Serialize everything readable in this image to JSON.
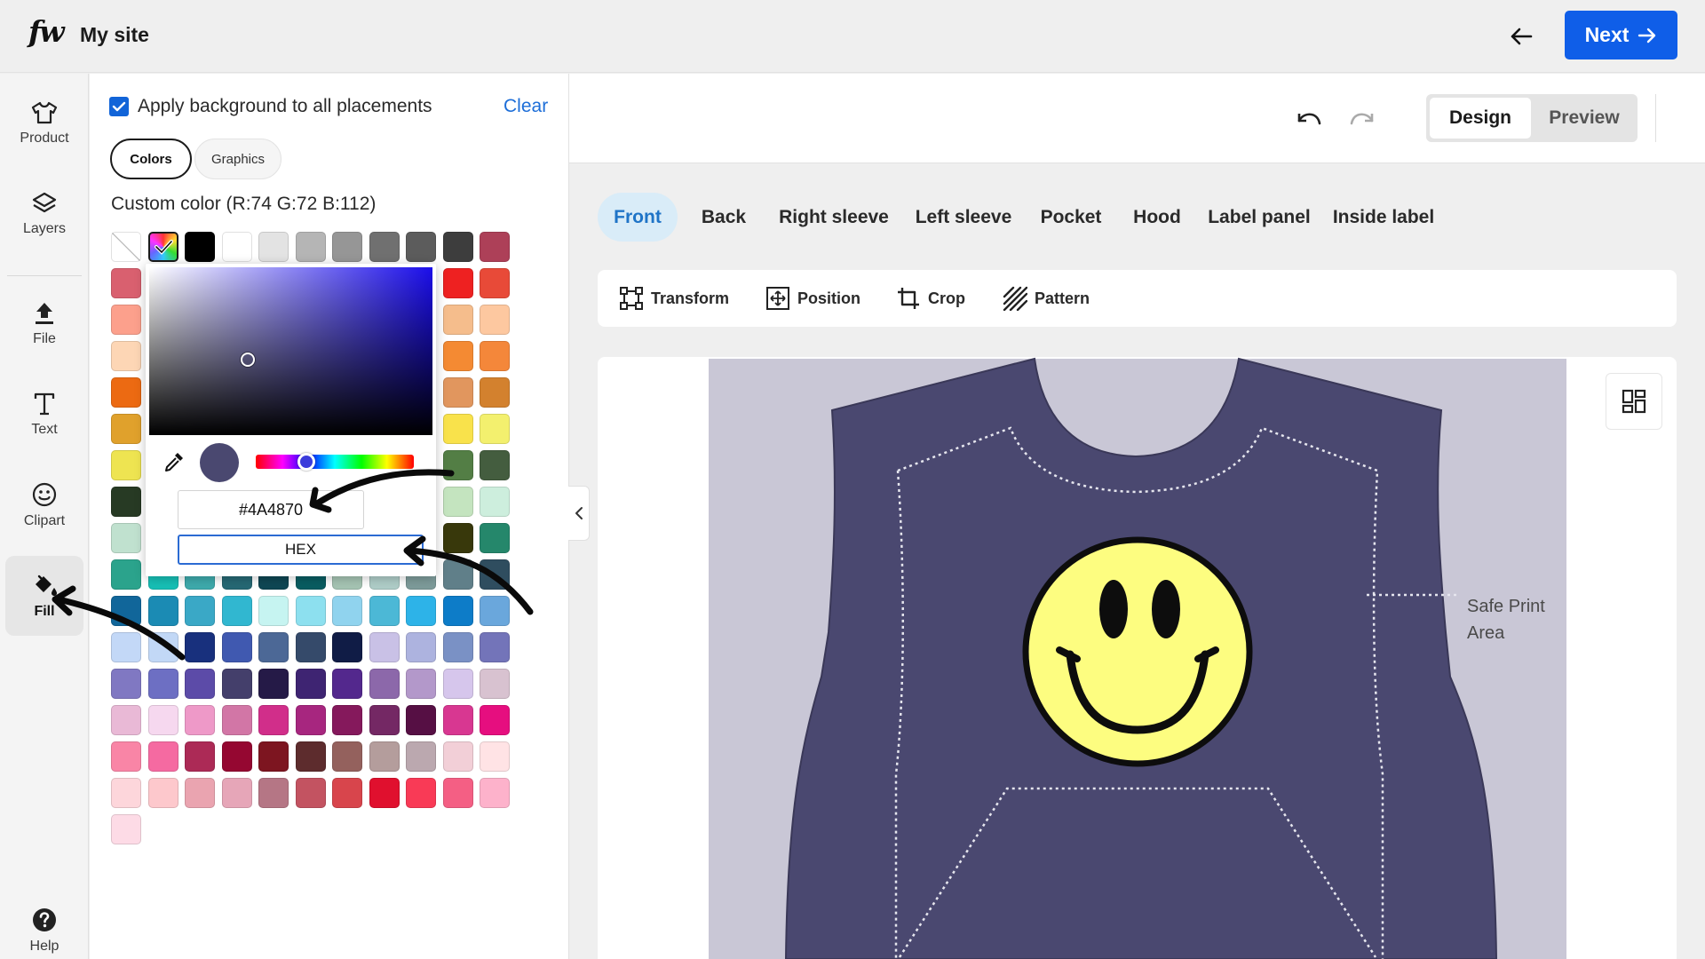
{
  "header": {
    "logo": "fw",
    "site_name": "My site",
    "next_label": "Next"
  },
  "rail": {
    "items": [
      {
        "label": "Product",
        "icon": "shirt-icon"
      },
      {
        "label": "Layers",
        "icon": "layers-icon"
      },
      {
        "label": "File",
        "icon": "upload-icon"
      },
      {
        "label": "Text",
        "icon": "text-icon"
      },
      {
        "label": "Clipart",
        "icon": "smiley-icon"
      },
      {
        "label": "Fill",
        "icon": "paint-bucket-icon"
      },
      {
        "label": "Help",
        "icon": "help-icon"
      }
    ]
  },
  "panel": {
    "apply_label": "Apply background to all placements",
    "apply_checked": true,
    "clear_label": "Clear",
    "pill_colors": "Colors",
    "pill_graphics": "Graphics",
    "custom_color": "Custom color  (R:74 G:72 B:112)",
    "swatches": [
      [
        "none",
        "rainbow",
        "#000000",
        "#ffffff",
        "#e3e3e3",
        "#b5b5b5",
        "#969696",
        "#707070",
        "#5c5c5c",
        "#3d3d3d",
        "#ad4058"
      ],
      [
        "#d9606f",
        "",
        "",
        "",
        "",
        "",
        "",
        "",
        "",
        "#ee2121",
        "#e84a38"
      ],
      [
        "#fca08c",
        "",
        "",
        "",
        "",
        "",
        "",
        "",
        "",
        "#f5bd8c",
        "#fdc8a0"
      ],
      [
        "#fdd6b5",
        "",
        "",
        "",
        "",
        "",
        "",
        "",
        "",
        "#f48a33",
        "#f4873a"
      ],
      [
        "#ec6a12",
        "",
        "",
        "",
        "",
        "",
        "",
        "",
        "",
        "#e1965e",
        "#d3812e"
      ],
      [
        "#e0a12c",
        "",
        "",
        "",
        "",
        "",
        "",
        "",
        "",
        "#f9e24b",
        "#f3f06e"
      ],
      [
        "#eee451",
        "",
        "",
        "",
        "",
        "",
        "",
        "",
        "",
        "#537e45",
        "#445d3f"
      ],
      [
        "#273a24",
        "",
        "",
        "",
        "",
        "",
        "",
        "",
        "",
        "#c4e4bf",
        "#cdeedd"
      ],
      [
        "#c0e1cf",
        "",
        "",
        "",
        "",
        "",
        "",
        "",
        "",
        "#38380b",
        "#25876b"
      ],
      [
        "#2ba38c",
        "#17bfb5",
        "#3eaaac",
        "#266874",
        "#0f4754",
        "#095d61",
        "#a5c4b3",
        "#afcdc8",
        "#7d9b9a",
        "#607f89",
        "#2f4d5f"
      ],
      [
        "#11669a",
        "#1b8bb4",
        "#3aa8c6",
        "#31b7d0",
        "#c6f4f1",
        "#8de0ef",
        "#90d3ee",
        "#4cb8d6",
        "#2db3e8",
        "#0d7cc8",
        "#6aa7dc"
      ],
      [
        "#c3d8f7",
        "#c2d8f6",
        "#18307d",
        "#4059b0",
        "#4c6896",
        "#354a6a",
        "#101c46",
        "#c9c1e6",
        "#adb3df",
        "#7a91c5",
        "#7374b9"
      ],
      [
        "#8078c2",
        "#6d6fc3",
        "#5c4ba8",
        "#443f6b",
        "#251a47",
        "#3e2472",
        "#53288d",
        "#8c68aa",
        "#b398ca",
        "#d6c6ec",
        "#d8c2d0"
      ],
      [
        "#e9b9d6",
        "#f6d8ef",
        "#ee99c8",
        "#d276a6",
        "#d12e8a",
        "#a7267f",
        "#85195c",
        "#742864",
        "#560f44",
        "#d83791",
        "#e60e7f"
      ],
      [
        "#f985a6",
        "#f56aa1",
        "#ac2a56",
        "#950731",
        "#7d1520",
        "#5d2c2d",
        "#94615d",
        "#b49d9c",
        "#bba8af",
        "#f2cfd7",
        "#ffe3e5"
      ],
      [
        "#fdd6db",
        "#fdc8cc",
        "#eaa4b0",
        "#e6a6b8",
        "#b57685",
        "#c35361",
        "#d8454c",
        "#e0102e",
        "#f93a56",
        "#f45f84",
        "#fdb2cb"
      ],
      [
        "#fddbe6",
        "",
        "",
        "",
        "",
        "",
        "",
        "",
        "",
        "",
        ""
      ]
    ]
  },
  "picker": {
    "hex_value": "#4A4870",
    "mode": "HEX",
    "current_color": "#4a4870"
  },
  "editor": {
    "undo_icon": "undo-icon",
    "redo_icon": "redo-icon",
    "design_label": "Design",
    "preview_label": "Preview",
    "tabs": [
      "Front",
      "Back",
      "Right sleeve",
      "Left sleeve",
      "Pocket",
      "Hood",
      "Label panel",
      "Inside label"
    ],
    "active_tab": "Front",
    "tools": [
      "Transform",
      "Position",
      "Crop",
      "Pattern"
    ],
    "safe_print_line1": "Safe Print",
    "safe_print_line2": "Area",
    "garment_color": "#4a4870",
    "background_color": "#c9c7d6",
    "smiley_color": "#fdfd80"
  }
}
